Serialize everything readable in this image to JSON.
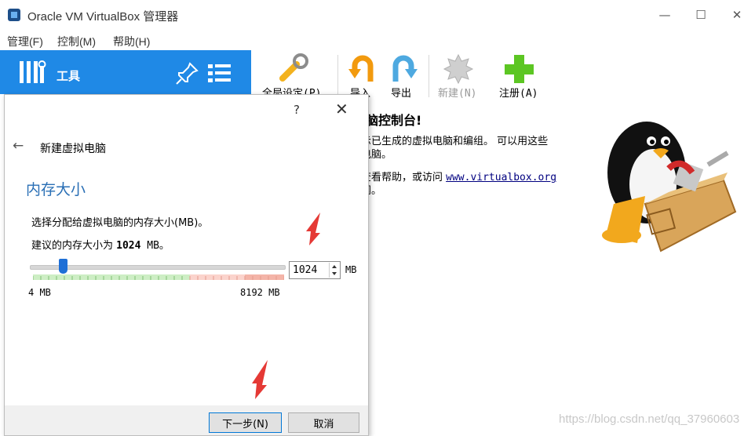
{
  "window": {
    "title": "Oracle VM VirtualBox 管理器"
  },
  "menu": [
    {
      "label": "管理(F)"
    },
    {
      "label": "控制(M)"
    },
    {
      "label": "帮助(H)"
    }
  ],
  "sidebar": {
    "tools_label": "工具"
  },
  "toolbar": {
    "buttons": [
      {
        "label": "全局设定(P)",
        "icon": "wrench-icon",
        "enabled": true
      },
      {
        "label": "导入",
        "icon": "import-icon",
        "enabled": true
      },
      {
        "label": "导出",
        "icon": "export-icon",
        "enabled": true
      },
      {
        "label": "新建(N)",
        "icon": "new-icon",
        "enabled": false
      },
      {
        "label": "注册(A)",
        "icon": "add-icon",
        "enabled": true
      }
    ]
  },
  "welcome": {
    "title": "脑控制台!",
    "line1": "示已生成的虚拟电脑和编组。 可以用这些",
    "line2": "电脑。",
    "line3_prefix": "查看帮助，或访问 ",
    "line3_link": "www.virtualbox.org",
    "line4": "闻。"
  },
  "dialog": {
    "help": "?",
    "close": "✕",
    "back": "←",
    "heading": "新建虚拟电脑",
    "section_title": "内存大小",
    "desc1": "选择分配给虚拟电脑的内存大小(MB)。",
    "desc2_prefix": "建议的内存大小为 ",
    "desc2_value": "1024",
    "desc2_suffix": " MB。",
    "memory": {
      "value": "1024",
      "unit": "MB",
      "min_label": "4 MB",
      "max_label": "8192 MB",
      "level": 0.125
    },
    "next_label": "下一步(N)",
    "cancel_label": "取消"
  },
  "watermark": "https://blog.csdn.net/qq_37960603",
  "colors": {
    "accent": "#1f89e6",
    "section": "#2a6fb5",
    "arrow": "#e53935"
  }
}
